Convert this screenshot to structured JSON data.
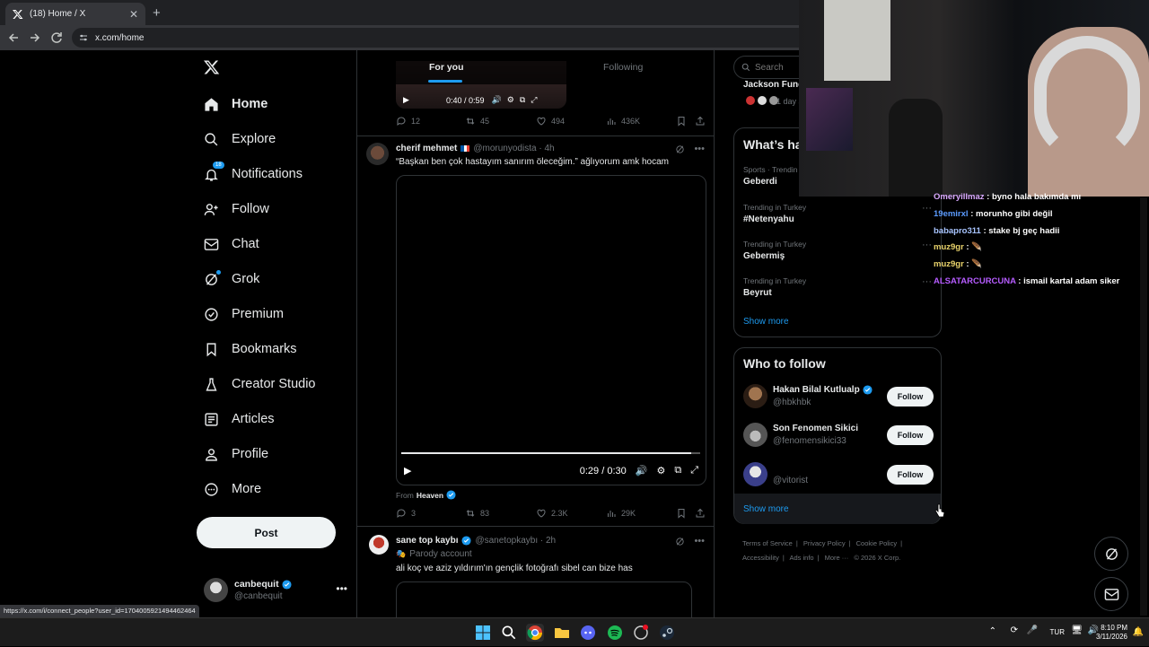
{
  "browser": {
    "tab_title": "(18) Home / X",
    "url": "x.com/home",
    "status_url": "https://x.com/i/connect_people?user_id=1704005921494462464"
  },
  "nav": {
    "items": [
      {
        "label": "Home",
        "icon": "home-icon"
      },
      {
        "label": "Explore",
        "icon": "search-icon"
      },
      {
        "label": "Notifications",
        "icon": "bell-icon",
        "badge": "18"
      },
      {
        "label": "Follow",
        "icon": "person-plus-icon"
      },
      {
        "label": "Chat",
        "icon": "mail-icon"
      },
      {
        "label": "Grok",
        "icon": "grok-icon"
      },
      {
        "label": "Premium",
        "icon": "premium-icon"
      },
      {
        "label": "Bookmarks",
        "icon": "bookmark-icon"
      },
      {
        "label": "Creator Studio",
        "icon": "flask-icon"
      },
      {
        "label": "Articles",
        "icon": "article-icon"
      },
      {
        "label": "Profile",
        "icon": "person-icon"
      },
      {
        "label": "More",
        "icon": "more-circle-icon"
      }
    ],
    "post_label": "Post",
    "account_name": "canbequit",
    "account_handle": "@canbequit"
  },
  "feed": {
    "tabs": {
      "for_you": "For you",
      "following": "Following"
    },
    "top_video_time": "0:40 / 0:59",
    "top_stats": {
      "replies": "12",
      "reposts": "45",
      "likes": "494",
      "views": "436K"
    },
    "tweet1": {
      "name": "cherif mehmet",
      "handle": "@morunyodista",
      "time": "4h",
      "text": "“Başkan ben çok hastayım sanırım öleceğim.” ağlıyorum amk hocam",
      "video_time": "0:29 / 0:30",
      "progress": 0.97,
      "from_label": "From",
      "from_source": "Heaven",
      "stats": {
        "replies": "3",
        "reposts": "83",
        "likes": "2.3K",
        "views": "29K"
      }
    },
    "tweet2": {
      "name": "sane top kaybı",
      "handle": "@sanetopkaybı",
      "time": "2h",
      "parody": "Parody account",
      "text": "ali koç ve aziz yıldırım'ın gençlik fotoğrafı sibel can bize has"
    }
  },
  "sidebar": {
    "search_placeholder": "Search",
    "top_card_title": "Jackson Fune",
    "top_card_time": "1 day a",
    "trends_title": "What’s ha",
    "trends": [
      {
        "meta": "Sports · Trendin",
        "name": "Geberdi"
      },
      {
        "meta": "Trending in Turkey",
        "name": "#Netenyahu"
      },
      {
        "meta": "Trending in Turkey",
        "name": "Gebermiş"
      },
      {
        "meta": "Trending in Turkey",
        "name": "Beyrut"
      }
    ],
    "show_more": "Show more",
    "who_title": "Who to follow",
    "who": [
      {
        "name": "Hakan Bilal Kutlualp",
        "handle": "@hbkhbk",
        "verified": true
      },
      {
        "name": "Son Fenomen Sikici",
        "handle": "@fenomensikici33",
        "verified": false
      },
      {
        "name": "",
        "handle": "@vitorist",
        "verified": false
      }
    ],
    "follow_label": "Follow",
    "footer": [
      "Terms of Service",
      "Privacy Policy",
      "Cookie Policy",
      "Accessibility",
      "Ads info",
      "More ···",
      "© 2026 X Corp."
    ]
  },
  "chat": [
    {
      "user": "Omeryillmaz",
      "text": " : byno hala bakımda mı",
      "color": "#d9a8ff"
    },
    {
      "user": "19emirxl",
      "text": " : morunho gibi değil",
      "color": "#5b9bff"
    },
    {
      "user": "babapro311",
      "text": " : stake bj geç hadii",
      "color": "#a8c4ff"
    },
    {
      "user": "muz9gr",
      "text": " : 🪶",
      "color": "#e9d36b"
    },
    {
      "user": "muz9gr",
      "text": " : 🪶",
      "color": "#e9d36b"
    },
    {
      "user": "ALSATARCURCUNA",
      "text": " : ismail kartal adam siker",
      "color": "#b65cff"
    }
  ],
  "taskbar": {
    "lang": "TUR",
    "time": "8:10 PM",
    "date": "3/11/2026"
  },
  "colors": {
    "accent": "#1d9bf0",
    "bg": "#000000",
    "border": "#2f3336",
    "muted": "#71767b"
  }
}
